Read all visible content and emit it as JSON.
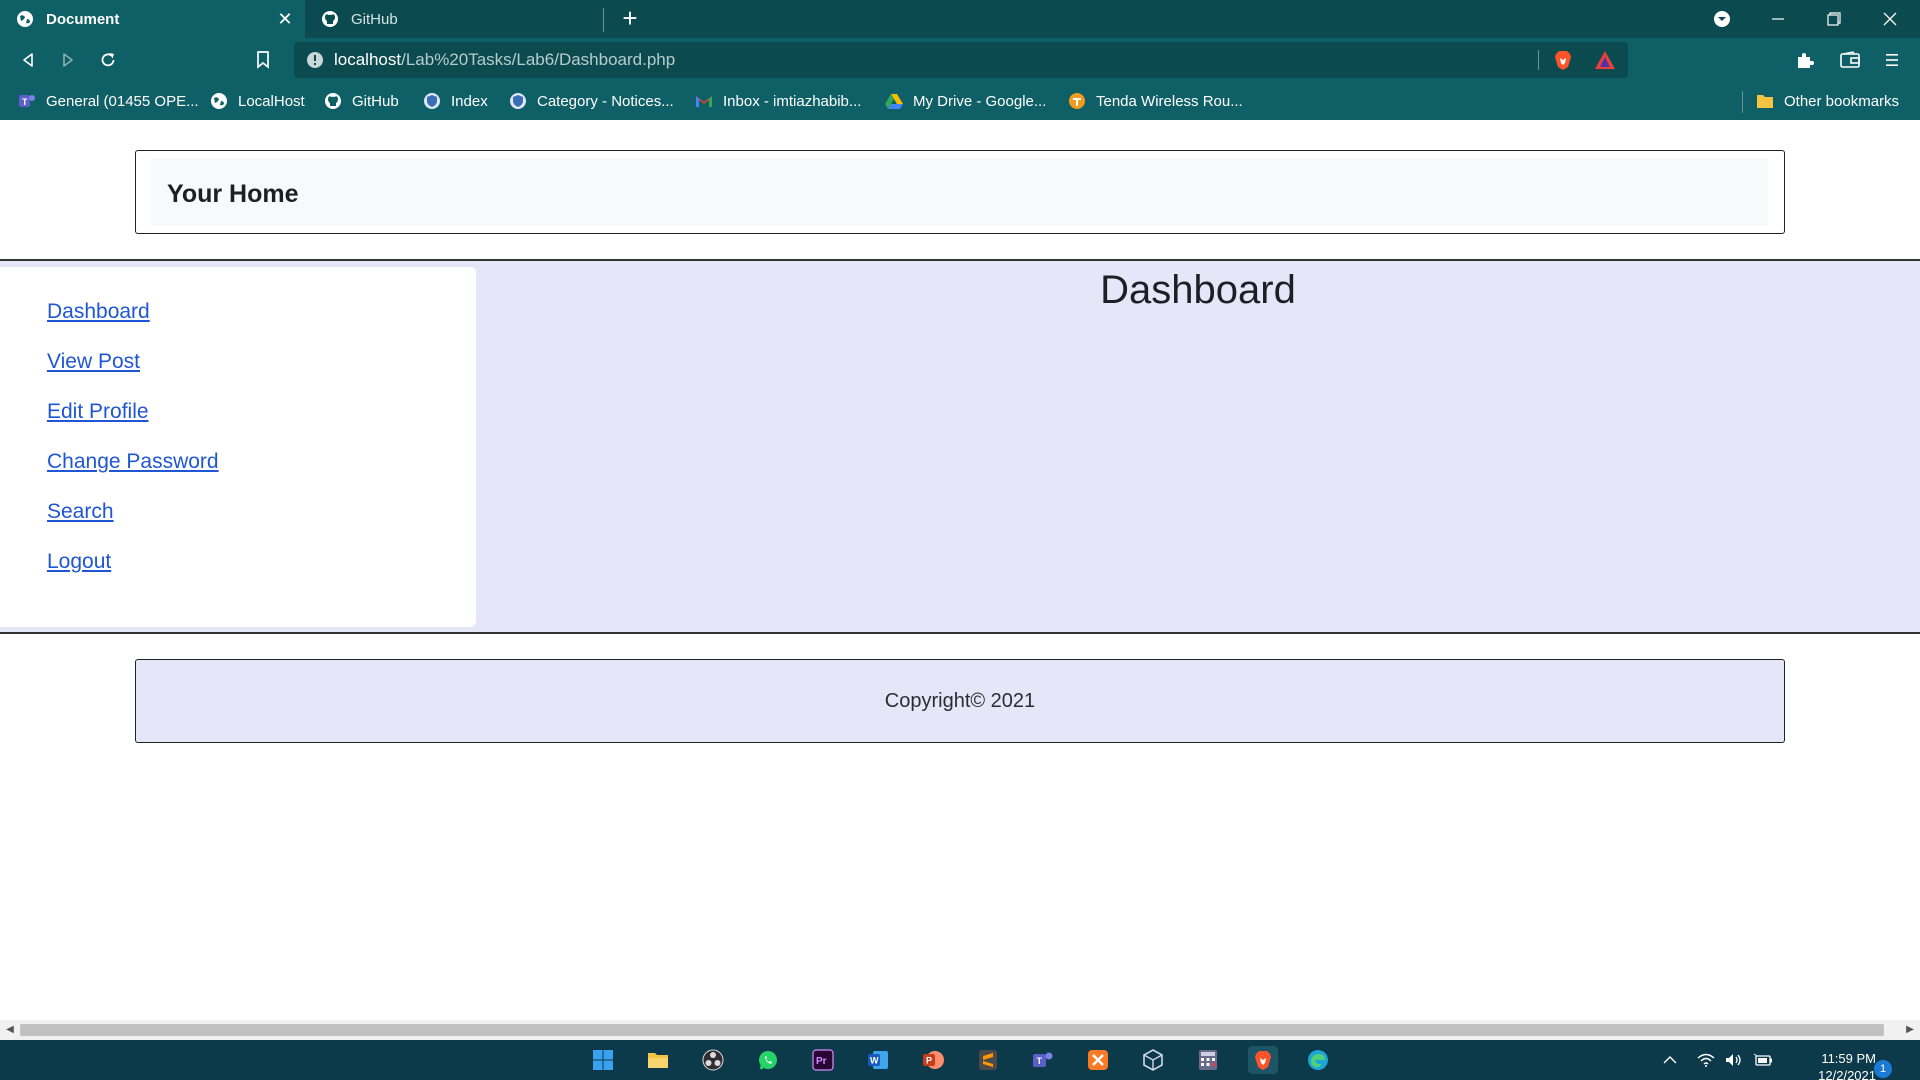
{
  "browser": {
    "tabs": [
      {
        "title": "Document",
        "icon": "globe-icon",
        "active": true
      },
      {
        "title": "GitHub",
        "icon": "github-icon",
        "active": false
      }
    ],
    "close_glyph": "✕",
    "new_tab_glyph": "+",
    "url": {
      "host": "localhost",
      "path": "/Lab%20Tasks/Lab6/Dashboard.php"
    },
    "bookmarks": [
      {
        "label": "General (01455 OPE...",
        "icon": "teams-icon"
      },
      {
        "label": "LocalHost",
        "icon": "globe-icon"
      },
      {
        "label": "GitHub",
        "icon": "github-icon"
      },
      {
        "label": "Index",
        "icon": "shield-icon"
      },
      {
        "label": "Category - Notices...",
        "icon": "shield-icon"
      },
      {
        "label": "Inbox - imtiazhabib...",
        "icon": "gmail-icon"
      },
      {
        "label": "My Drive - Google...",
        "icon": "drive-icon"
      },
      {
        "label": "Tenda Wireless Rou...",
        "icon": "tenda-icon"
      }
    ],
    "other_bookmarks": "Other bookmarks",
    "colors": {
      "chrome_dark": "#0b4a4f",
      "chrome": "#0f6066"
    }
  },
  "page": {
    "header_title": "Your Home",
    "sidebar_links": [
      "Dashboard",
      "View Post",
      "Edit Profile",
      "Change Password",
      "Search",
      "Logout"
    ],
    "content_title": "Dashboard",
    "footer_text": "Copyright© 2021",
    "colors": {
      "content_bg": "#e6e6f9",
      "link": "#1f56d4"
    }
  },
  "taskbar": {
    "apps": [
      "windows-start-icon",
      "file-explorer-icon",
      "obs-icon",
      "whatsapp-icon",
      "premiere-icon",
      "word-icon",
      "powerpoint-icon",
      "sublime-icon",
      "teams-icon",
      "xampp-icon",
      "virtualbox-icon",
      "calculator-icon",
      "brave-icon",
      "edge-icon"
    ],
    "time": "11:59 PM",
    "date": "12/2/2021",
    "notification_count": "1"
  }
}
